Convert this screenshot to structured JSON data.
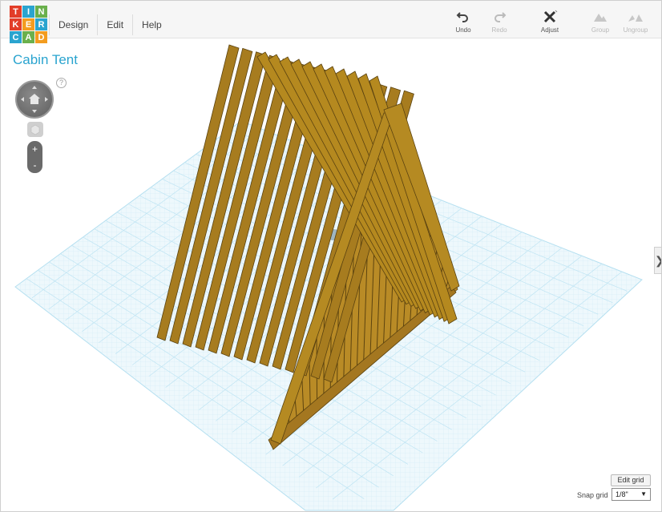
{
  "app": {
    "logo_letters": [
      {
        "letter": "T",
        "color": "#e23d28"
      },
      {
        "letter": "I",
        "color": "#2aa4cf"
      },
      {
        "letter": "N",
        "color": "#6ab04c"
      },
      {
        "letter": "K",
        "color": "#e23d28"
      },
      {
        "letter": "E",
        "color": "#f39c1f"
      },
      {
        "letter": "R",
        "color": "#2aa4cf"
      },
      {
        "letter": "C",
        "color": "#2aa4cf"
      },
      {
        "letter": "A",
        "color": "#6ab04c"
      },
      {
        "letter": "D",
        "color": "#f39c1f"
      }
    ]
  },
  "menu": {
    "design": "Design",
    "edit": "Edit",
    "help": "Help"
  },
  "toolbar": {
    "undo": "Undo",
    "redo": "Redo",
    "adjust": "Adjust",
    "group": "Group",
    "ungroup": "Ungroup"
  },
  "project": {
    "title": "Cabin Tent"
  },
  "view_controls": {
    "help": "?",
    "zoom_in": "+",
    "zoom_out": "-"
  },
  "grid": {
    "edit_grid": "Edit grid",
    "snap_label": "Snap grid",
    "snap_value": "1/8\""
  },
  "side_panel_toggle": "❯",
  "colors": {
    "accent": "#2aa4cf",
    "wood": "#a77c1f",
    "grid": "#d9f0fa"
  }
}
